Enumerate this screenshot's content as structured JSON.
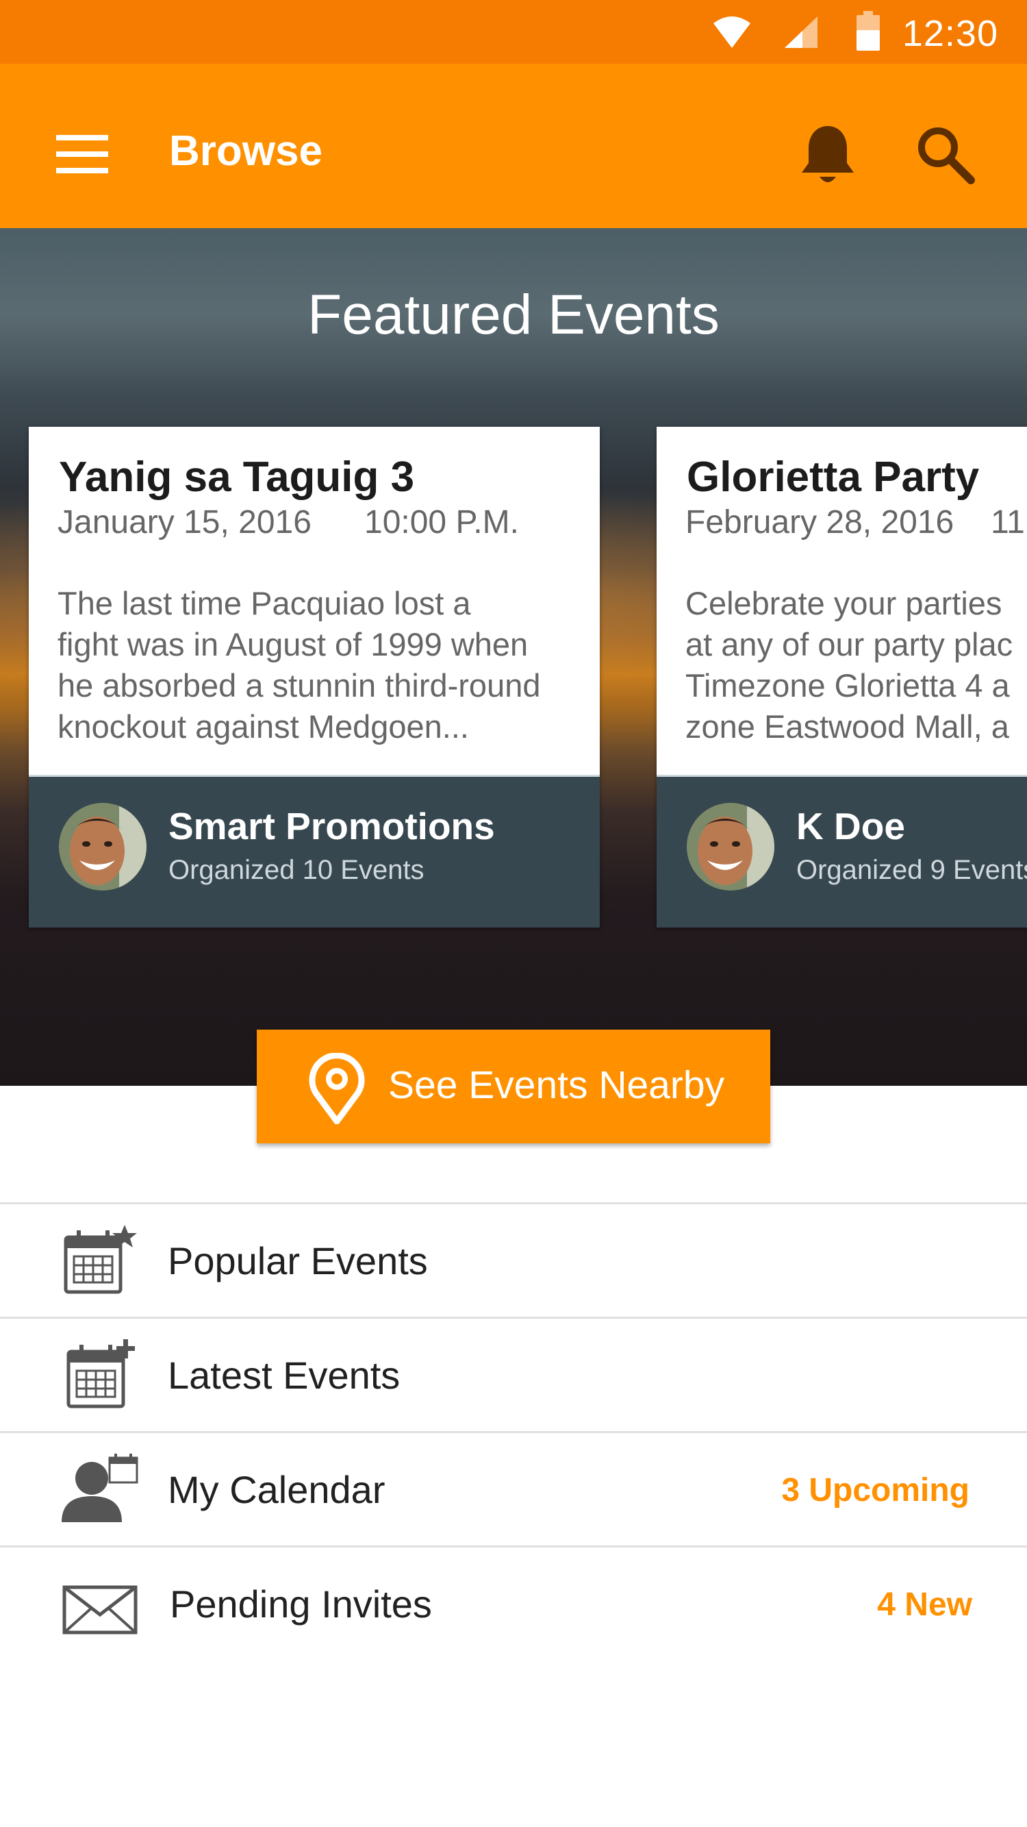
{
  "status_bar": {
    "time": "12:30"
  },
  "app_bar": {
    "title": "Browse"
  },
  "hero": {
    "title": "Featured Events"
  },
  "featured_events": [
    {
      "title": "Yanig sa Taguig 3",
      "date": "January 15, 2016",
      "time": "10:00 P.M.",
      "description": [
        "The last time Pacquiao lost a",
        "fight was in August of 1999 when",
        "he absorbed a stunnin third-round",
        "knockout against Medgoen..."
      ],
      "organizer": "Smart Promotions",
      "organizer_count": "Organized 10 Events"
    },
    {
      "title": "Glorietta Party",
      "date": "February 28, 2016",
      "time": "11",
      "description": [
        "Celebrate your parties",
        "at any of our party plac",
        "Timezone Glorietta 4 a",
        "zone Eastwood Mall, a"
      ],
      "organizer": "K Doe",
      "organizer_count": "Organized 9 Events"
    }
  ],
  "nearby_button": {
    "label": "See Events Nearby"
  },
  "menu": [
    {
      "label": "Popular Events",
      "badge": "",
      "icon": "calendar-star-icon"
    },
    {
      "label": "Latest Events",
      "badge": "",
      "icon": "calendar-plus-icon"
    },
    {
      "label": "My Calendar",
      "badge": "3 Upcoming",
      "icon": "person-calendar-icon"
    },
    {
      "label": "Pending Invites",
      "badge": "4 New",
      "icon": "envelope-icon"
    }
  ],
  "colors": {
    "status_bar": "#f57c00",
    "primary": "#ff9100",
    "card_footer": "#37474f",
    "accent_text": "#ff9100"
  }
}
